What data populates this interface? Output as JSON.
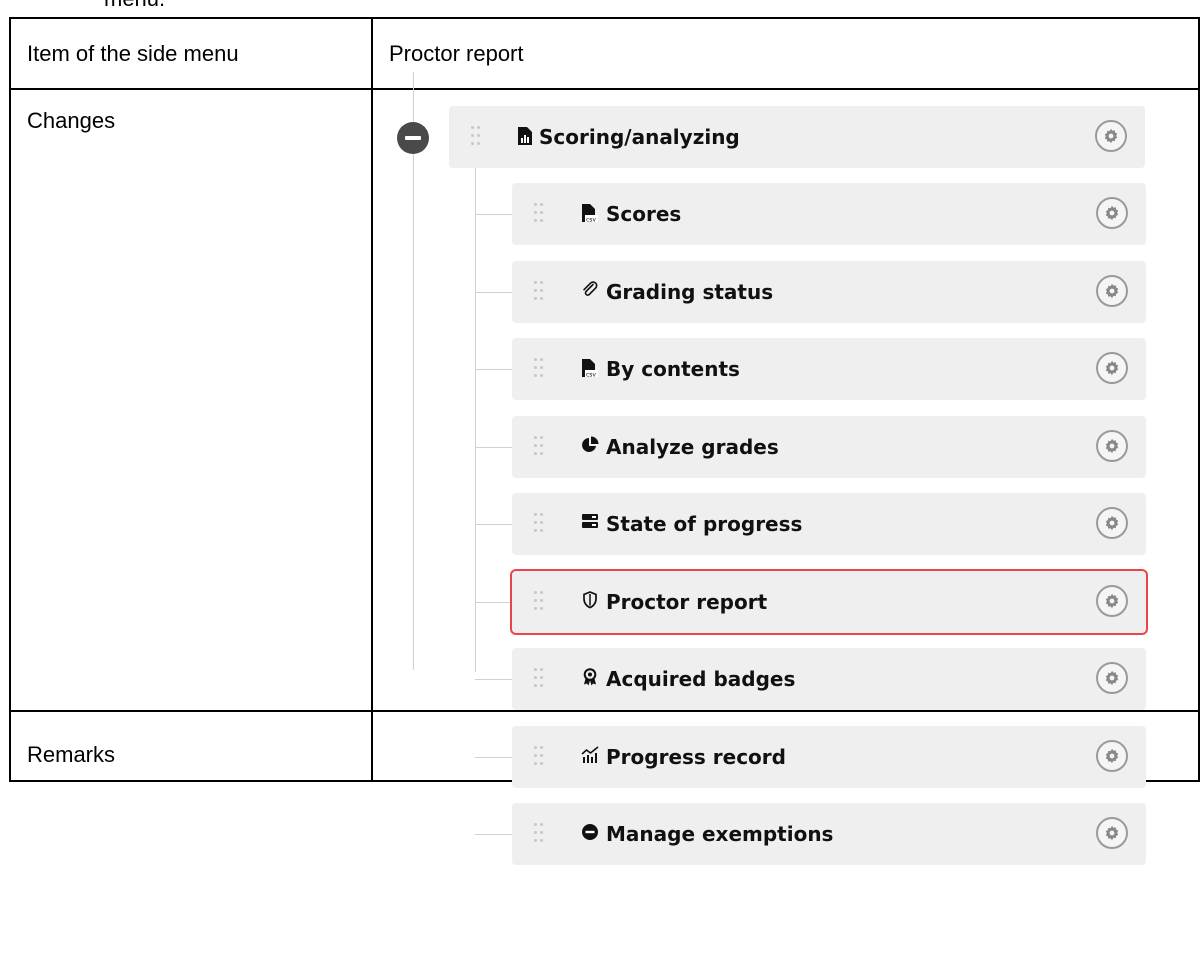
{
  "top_text": "menu.",
  "table": {
    "row1": {
      "label": "Item of the side menu",
      "value": "Proctor report"
    },
    "row2": {
      "label": "Changes"
    },
    "row3": {
      "label": "Remarks",
      "value": ""
    }
  },
  "menu": {
    "parent": {
      "label": "Scoring/analyzing",
      "icon": "file-chart-icon"
    },
    "children": [
      {
        "label": "Scores",
        "icon": "file-csv-icon",
        "highlighted": false
      },
      {
        "label": "Grading status",
        "icon": "paperclip-icon",
        "highlighted": false
      },
      {
        "label": "By contents",
        "icon": "file-csv-icon",
        "highlighted": false
      },
      {
        "label": "Analyze grades",
        "icon": "pie-chart-icon",
        "highlighted": false
      },
      {
        "label": "State of progress",
        "icon": "server-icon",
        "highlighted": false
      },
      {
        "label": "Proctor report",
        "icon": "shield-icon",
        "highlighted": true
      },
      {
        "label": "Acquired badges",
        "icon": "award-icon",
        "highlighted": false
      },
      {
        "label": "Progress record",
        "icon": "chart-line-icon",
        "highlighted": false
      },
      {
        "label": "Manage exemptions",
        "icon": "minus-circle-icon",
        "highlighted": false
      }
    ]
  },
  "colors": {
    "highlight": "#e8464b",
    "row_bg": "#efefef",
    "tree_line": "#d0d0d0"
  }
}
